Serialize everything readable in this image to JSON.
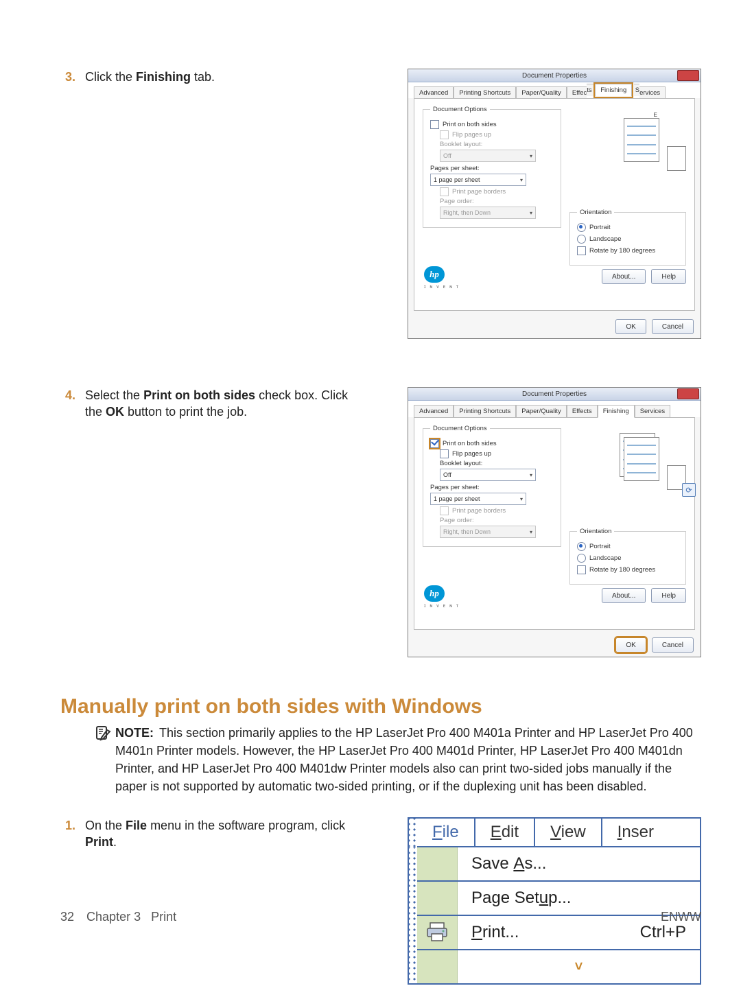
{
  "step3": {
    "num": "3.",
    "pre": "Click the ",
    "bold": "Finishing",
    "post": " tab."
  },
  "step4": {
    "num": "4.",
    "pre": "Select the ",
    "bold1": "Print on both sides",
    "mid": " check box. Click the ",
    "bold2": "OK",
    "post": " button to print the job."
  },
  "sectionHead": "Manually print on both sides with Windows",
  "note": {
    "label": "NOTE:",
    "body": "This section primarily applies to the HP LaserJet Pro 400 M401a Printer and HP LaserJet Pro 400 M401n Printer models. However, the HP LaserJet Pro 400 M401d Printer, HP LaserJet Pro 400 M401dn Printer, and HP LaserJet Pro 400 M401dw Printer models also can print two-sided jobs manually if the paper is not supported by automatic two-sided printing, or if the duplexing unit has been disabled."
  },
  "step1": {
    "num": "1.",
    "pre": "On the ",
    "bold1": "File",
    "mid": " menu in the software program, click ",
    "bold2": "Print",
    "post": "."
  },
  "footer": {
    "pageNum": "32",
    "chapterLabel": "Chapter 3",
    "chapterTitle": "Print",
    "right": "ENWW"
  },
  "dialog": {
    "title": "Document Properties",
    "tabs": [
      "Advanced",
      "Printing Shortcuts",
      "Paper/Quality",
      "Effects",
      "Finishing",
      "Services"
    ],
    "docOptionsLegend": "Document Options",
    "printBoth": "Print on both sides",
    "flipUp": "Flip pages up",
    "bookletLayout": "Booklet layout:",
    "bookletOff": "Off",
    "ppsLabel": "Pages per sheet:",
    "pps1": "1 page per sheet",
    "pageBorders": "Print page borders",
    "pageOrderLabel": "Page order:",
    "pageOrder": "Right, then Down",
    "orientLegend": "Orientation",
    "portrait": "Portrait",
    "landscape": "Landscape",
    "rotate180": "Rotate by 180 degrees",
    "hp": "hp",
    "hpSub": "ɪ ɴ ᴠ ᴇ ɴ ᴛ",
    "about": "About...",
    "help": "Help",
    "ok": "OK",
    "cancel": "Cancel",
    "tabsSplitA": "Effec",
    "tabsSplitB": "ts",
    "tabsSplitC": "S",
    "tabsSplitD": "ervices"
  },
  "fileMenu": {
    "bar": {
      "file": "File",
      "edit": "Edit",
      "view": "View",
      "inser": "Inser"
    },
    "saveAs": "Save As...",
    "pageSetup": "Page Setup...",
    "print": "Print...",
    "shortcut": "Ctrl+P",
    "expand": "˅"
  }
}
